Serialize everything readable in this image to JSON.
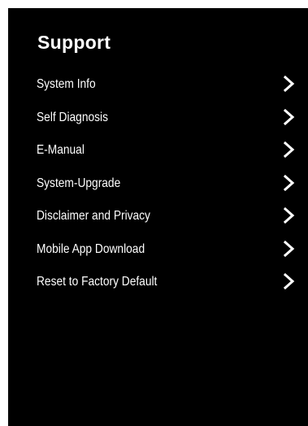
{
  "support": {
    "title": "Support",
    "items": [
      {
        "label": "System Info"
      },
      {
        "label": "Self Diagnosis"
      },
      {
        "label": "E-Manual"
      },
      {
        "label": "System-Upgrade"
      },
      {
        "label": "Disclaimer and Privacy"
      },
      {
        "label": "Mobile App Download"
      },
      {
        "label": "Reset to Factory Default"
      }
    ],
    "icon": "chevron-right-icon",
    "colors": {
      "background": "#000000",
      "text": "#ffffff",
      "outer": "#ffffff"
    }
  }
}
